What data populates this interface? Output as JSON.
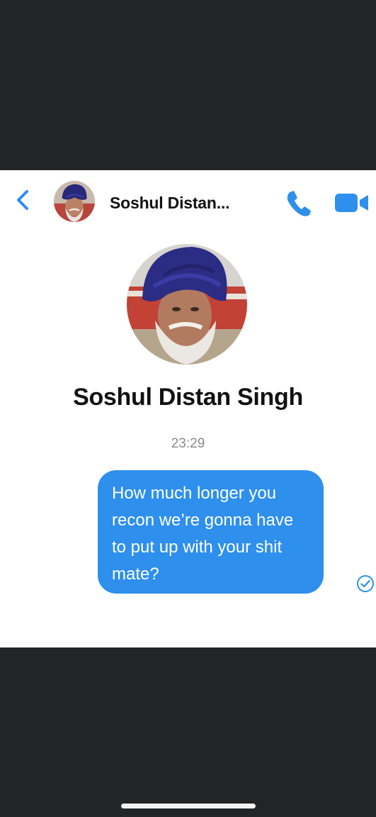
{
  "header": {
    "back_icon": "chevron-left-icon",
    "contact_name": "Soshul Distan...",
    "call_icon": "phone-icon",
    "video_icon": "video-camera-icon"
  },
  "profile": {
    "name": "Soshul Distan Singh"
  },
  "conversation": {
    "timestamp": "23:29",
    "messages": [
      {
        "direction": "outgoing",
        "lines": [
          "How much longer you",
          "recon we’re gonna have",
          "to put up with your shit",
          "mate?"
        ],
        "status_icon": "read-receipt-check-icon"
      }
    ]
  },
  "colors": {
    "accent": "#2e8fec",
    "background_dark": "#232425",
    "surface": "#ffffff",
    "text_primary": "#111111",
    "text_secondary": "#8a8a8a"
  }
}
